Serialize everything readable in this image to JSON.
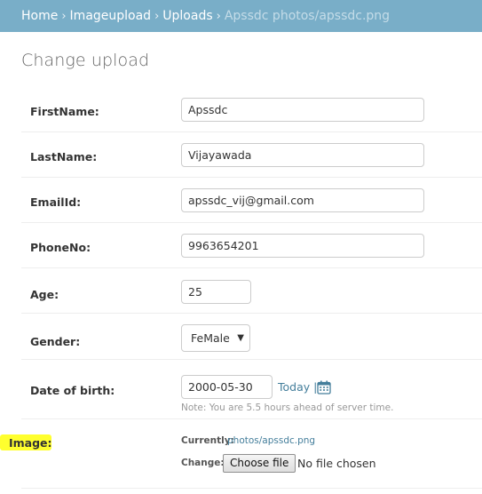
{
  "breadcrumb": {
    "items": [
      "Home",
      "Imageupload",
      "Uploads"
    ],
    "current": "Apssdc photos/apssdc.png",
    "separator": "›"
  },
  "page_title": "Change upload",
  "fields": {
    "first_name": {
      "label": "FirstName:",
      "value": "Apssdc"
    },
    "last_name": {
      "label": "LastName:",
      "value": "Vijayawada"
    },
    "email": {
      "label": "EmailId:",
      "value": "apssdc_vij@gmail.com"
    },
    "phone": {
      "label": "PhoneNo:",
      "value": "9963654201"
    },
    "age": {
      "label": "Age:",
      "value": "25"
    },
    "gender": {
      "label": "Gender:",
      "value": "FeMale"
    },
    "dob": {
      "label": "Date of birth:",
      "value": "2000-05-30",
      "today_link": "Today",
      "link_separator": "|",
      "help": "Note: You are 5.5 hours ahead of server time."
    },
    "image": {
      "label": "Image:",
      "currently_label": "Currently:",
      "currently_value": "photos/apssdc.png",
      "change_label": "Change:",
      "choose_button": "Choose file",
      "no_file": "No file chosen"
    }
  },
  "colors": {
    "header": "#79aec8",
    "link": "#447e9b",
    "highlight": "#ffff2e"
  },
  "icons": {
    "calendar": "calendar-icon"
  }
}
